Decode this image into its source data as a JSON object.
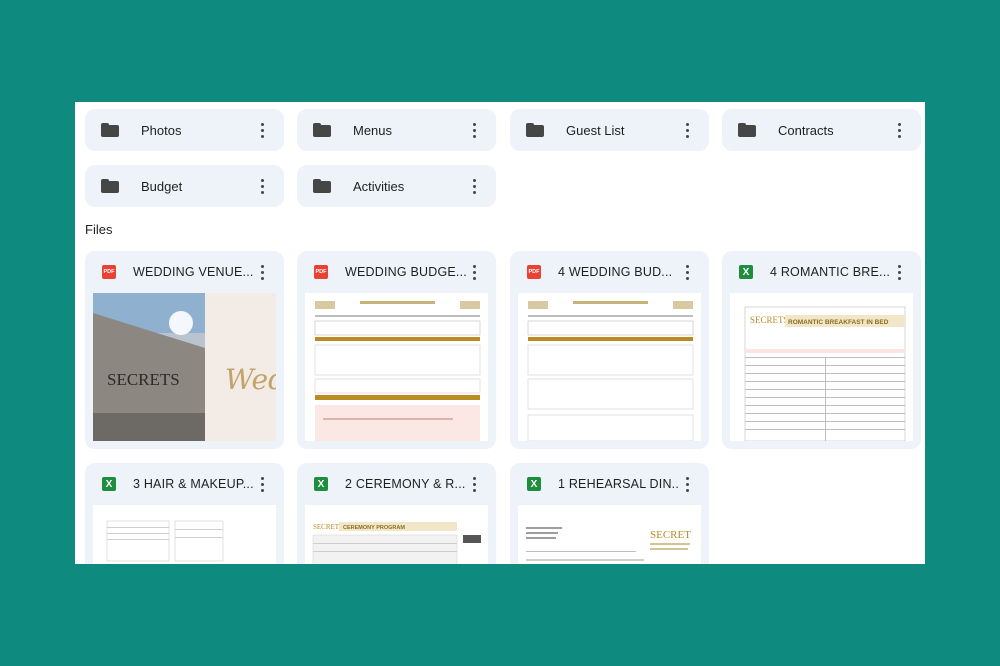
{
  "folders": [
    {
      "label": "Photos"
    },
    {
      "label": "Menus"
    },
    {
      "label": "Guest List"
    },
    {
      "label": "Contracts"
    },
    {
      "label": "Budget"
    },
    {
      "label": "Activities"
    }
  ],
  "files_section": {
    "label": "Files"
  },
  "files": [
    {
      "name": "WEDDING VENUE...",
      "type": "pdf",
      "type_label": "PDF"
    },
    {
      "name": "WEDDING BUDGE...",
      "type": "pdf",
      "type_label": "PDF"
    },
    {
      "name": "4 WEDDING BUD...",
      "type": "pdf",
      "type_label": "PDF"
    },
    {
      "name": "4 ROMANTIC BRE...",
      "type": "sheet",
      "type_label": "X"
    },
    {
      "name": "3 HAIR & MAKEUP...",
      "type": "sheet",
      "type_label": "X"
    },
    {
      "name": "2 CEREMONY & R...",
      "type": "sheet",
      "type_label": "X"
    },
    {
      "name": "1 REHEARSAL DIN...",
      "type": "sheet",
      "type_label": "X"
    }
  ],
  "thumbnails": {
    "venue_sign": "SECRETS",
    "venue_script": "Wedd",
    "romantic_title": "ROMANTIC BREAKFAST IN BED",
    "romantic_brand": "SECRETS",
    "ceremony_title": "CEREMONY PROGRAM",
    "ceremony_brand": "SECRETS",
    "rehearsal_brand": "SECRET"
  },
  "colors": {
    "background": "#0e8a7f",
    "tile": "#eef2f9",
    "pdf": "#e94235",
    "sheet": "#1e8e3e",
    "gold": "#b98c24"
  },
  "icons": {
    "folder": "folder-icon",
    "more": "more-vert-icon",
    "pdf": "pdf-file-icon",
    "sheet": "spreadsheet-file-icon"
  }
}
